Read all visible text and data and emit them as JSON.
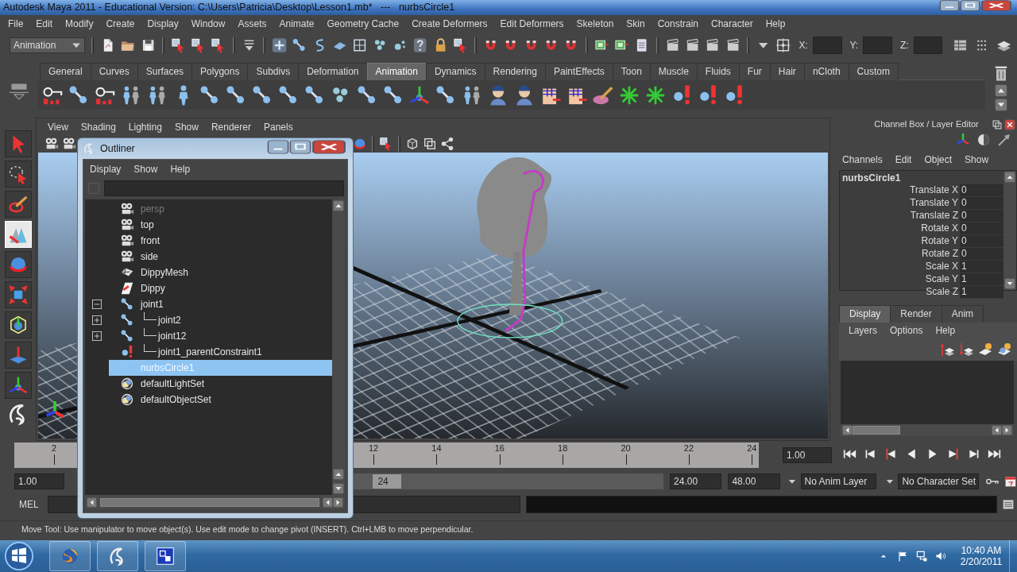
{
  "window": {
    "title": "Autodesk Maya 2011 - Educational Version: C:\\Users\\Patricia\\Desktop\\Lesson1.mb*   ---   nurbsCircle1"
  },
  "menu_bar": [
    "File",
    "Edit",
    "Modify",
    "Create",
    "Display",
    "Window",
    "Assets",
    "Animate",
    "Geometry Cache",
    "Create Deformers",
    "Edit Deformers",
    "Skeleton",
    "Skin",
    "Constrain",
    "Character",
    "Help"
  ],
  "status_line": {
    "mode": "Animation",
    "coordinate_labels": [
      "X:",
      "Y:",
      "Z:"
    ]
  },
  "shelf": {
    "tabs": [
      {
        "label": "General",
        "selected": false
      },
      {
        "label": "Curves",
        "selected": false
      },
      {
        "label": "Surfaces",
        "selected": false
      },
      {
        "label": "Polygons",
        "selected": false
      },
      {
        "label": "Subdivs",
        "selected": false
      },
      {
        "label": "Deformation",
        "selected": false
      },
      {
        "label": "Animation",
        "selected": true
      },
      {
        "label": "Dynamics",
        "selected": false
      },
      {
        "label": "Rendering",
        "selected": false
      },
      {
        "label": "PaintEffects",
        "selected": false
      },
      {
        "label": "Toon",
        "selected": false
      },
      {
        "label": "Muscle",
        "selected": false
      },
      {
        "label": "Fluids",
        "selected": false
      },
      {
        "label": "Fur",
        "selected": false
      },
      {
        "label": "Hair",
        "selected": false
      },
      {
        "label": "nCloth",
        "selected": false
      },
      {
        "label": "Custom",
        "selected": false
      }
    ]
  },
  "toolbox": {
    "tools": [
      {
        "selected": false
      },
      {
        "selected": false
      },
      {
        "selected": false
      },
      {
        "selected": true
      },
      {
        "selected": false
      },
      {
        "selected": false
      },
      {
        "selected": false
      },
      {
        "selected": false
      },
      {
        "selected": false
      }
    ]
  },
  "viewport": {
    "menu": [
      "View",
      "Shading",
      "Lighting",
      "Show",
      "Renderer",
      "Panels"
    ]
  },
  "outliner": {
    "title": "Outliner",
    "menu": [
      "Display",
      "Show",
      "Help"
    ],
    "items": [
      {
        "name": "persp",
        "kind": "camera",
        "dimmed": true,
        "selected": false
      },
      {
        "name": "top",
        "kind": "camera",
        "dimmed": false,
        "selected": false
      },
      {
        "name": "front",
        "kind": "camera",
        "dimmed": false,
        "selected": false
      },
      {
        "name": "side",
        "kind": "camera",
        "dimmed": false,
        "selected": false
      },
      {
        "name": "DippyMesh",
        "kind": "mesh",
        "dimmed": false,
        "selected": false
      },
      {
        "name": "Dippy",
        "kind": "shape",
        "dimmed": false,
        "selected": false
      },
      {
        "name": "joint1",
        "kind": "joint",
        "dimmed": false,
        "selected": false,
        "expanded": true,
        "children": [
          {
            "name": "joint2",
            "kind": "joint",
            "dimmed": false,
            "selected": false,
            "expanded": false
          },
          {
            "name": "joint12",
            "kind": "joint",
            "dimmed": false,
            "selected": false,
            "expanded": false
          },
          {
            "name": "joint1_parentConstraint1",
            "kind": "constraint",
            "dimmed": false,
            "selected": false
          }
        ]
      },
      {
        "name": "nurbsCircle1",
        "kind": "curve",
        "dimmed": false,
        "selected": true
      },
      {
        "name": "defaultLightSet",
        "kind": "set",
        "dimmed": false,
        "selected": false
      },
      {
        "name": "defaultObjectSet",
        "kind": "set",
        "dimmed": false,
        "selected": false
      }
    ]
  },
  "channel_box": {
    "title": "Channel Box / Layer Editor",
    "menu": [
      "Channels",
      "Edit",
      "Object",
      "Show"
    ],
    "object": "nurbsCircle1",
    "channels": [
      {
        "name": "Translate X",
        "value": "0"
      },
      {
        "name": "Translate Y",
        "value": "0"
      },
      {
        "name": "Translate Z",
        "value": "0"
      },
      {
        "name": "Rotate X",
        "value": "0"
      },
      {
        "name": "Rotate Y",
        "value": "0"
      },
      {
        "name": "Rotate Z",
        "value": "0"
      },
      {
        "name": "Scale X",
        "value": "1"
      },
      {
        "name": "Scale Y",
        "value": "1"
      },
      {
        "name": "Scale Z",
        "value": "1"
      }
    ]
  },
  "layer_editor": {
    "tabs": [
      {
        "label": "Display",
        "selected": true
      },
      {
        "label": "Render",
        "selected": false
      },
      {
        "label": "Anim",
        "selected": false
      }
    ],
    "menu": [
      "Layers",
      "Options",
      "Help"
    ]
  },
  "time_slider": {
    "ticks": [
      "2",
      "12",
      "14",
      "16",
      "18",
      "20",
      "22",
      "24"
    ],
    "current_time": "1.00"
  },
  "range_slider": {
    "start": "1.00",
    "handle": "24",
    "end": "24.00",
    "max": "48.00",
    "anim_layer": "No Anim Layer",
    "character_set": "No Character Set"
  },
  "command_line": {
    "language": "MEL"
  },
  "help_line": "Move Tool: Use manipulator to move object(s). Use edit mode to change pivot (INSERT).  Ctrl+LMB to move perpendicular.",
  "taskbar": {
    "time": "10:40 AM",
    "date": "2/20/2011"
  }
}
